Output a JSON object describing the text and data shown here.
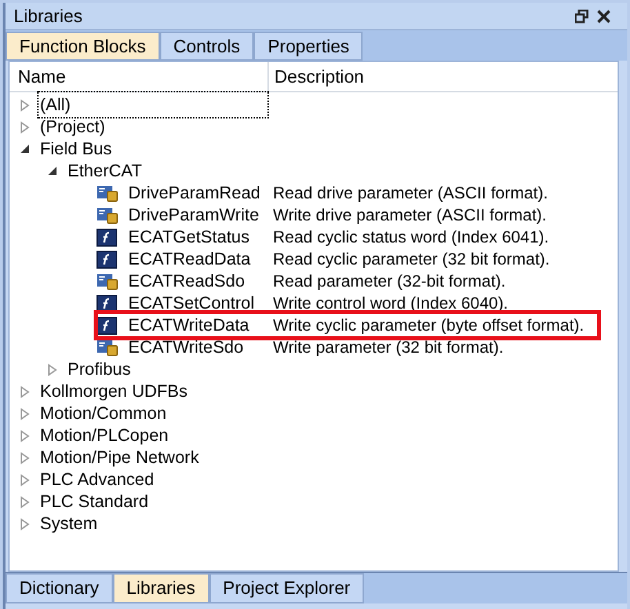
{
  "panel": {
    "title": "Libraries"
  },
  "top_tabs": [
    {
      "label": "Function Blocks",
      "selected": true
    },
    {
      "label": "Controls",
      "selected": false
    },
    {
      "label": "Properties",
      "selected": false
    }
  ],
  "columns": [
    "Name",
    "Description"
  ],
  "tree": [
    {
      "label": "(All)",
      "expanded": false,
      "focused": true
    },
    {
      "label": "(Project)",
      "expanded": false,
      "focused": false
    },
    {
      "label": "Field Bus",
      "expanded": true,
      "focused": false,
      "children": [
        {
          "label": "EtherCAT",
          "expanded": true,
          "focused": false,
          "children": [
            {
              "label": "DriveParamRead",
              "kind": "udfb",
              "description": "Read drive parameter (ASCII format).",
              "highlighted": false
            },
            {
              "label": "DriveParamWrite",
              "kind": "udfb",
              "description": "Write drive parameter (ASCII format).",
              "highlighted": false
            },
            {
              "label": "ECATGetStatus",
              "kind": "fb",
              "description": "Read cyclic status word (Index 6041).",
              "highlighted": false
            },
            {
              "label": "ECATReadData",
              "kind": "fb",
              "description": "Read cyclic parameter (32 bit format).",
              "highlighted": false
            },
            {
              "label": "ECATReadSdo",
              "kind": "udfb",
              "description": "Read parameter (32-bit format).",
              "highlighted": false
            },
            {
              "label": "ECATSetControl",
              "kind": "fb",
              "description": "Write control word (Index 6040).",
              "highlighted": false
            },
            {
              "label": "ECATWriteData",
              "kind": "fb",
              "description": "Write cyclic parameter (byte offset format).",
              "highlighted": true
            },
            {
              "label": "ECATWriteSdo",
              "kind": "udfb",
              "description": "Write parameter (32 bit format).",
              "highlighted": false
            }
          ]
        },
        {
          "label": "Profibus",
          "expanded": false,
          "focused": false
        }
      ]
    },
    {
      "label": "Kollmorgen UDFBs",
      "expanded": false,
      "focused": false
    },
    {
      "label": "Motion/Common",
      "expanded": false,
      "focused": false
    },
    {
      "label": "Motion/PLCopen",
      "expanded": false,
      "focused": false
    },
    {
      "label": "Motion/Pipe Network",
      "expanded": false,
      "focused": false
    },
    {
      "label": "PLC Advanced",
      "expanded": false,
      "focused": false
    },
    {
      "label": "PLC Standard",
      "expanded": false,
      "focused": false
    },
    {
      "label": "System",
      "expanded": false,
      "focused": false
    }
  ],
  "bottom_tabs": [
    {
      "label": "Dictionary",
      "selected": false
    },
    {
      "label": "Libraries",
      "selected": true
    },
    {
      "label": "Project Explorer",
      "selected": false
    }
  ]
}
